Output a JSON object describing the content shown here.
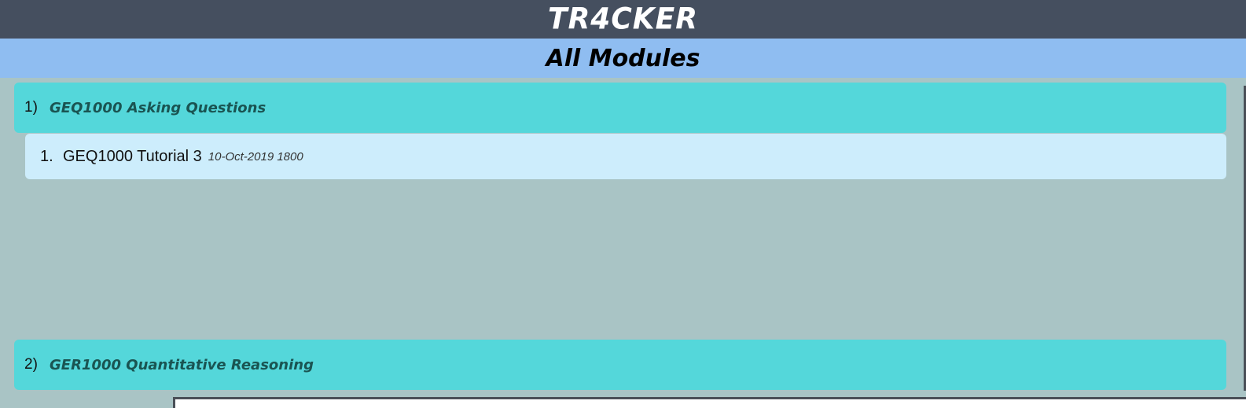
{
  "app": {
    "title": "TR4CKER"
  },
  "view": {
    "title": "All Modules"
  },
  "modules": [
    {
      "index": "1)",
      "name": "GEQ1000 Asking Questions",
      "tasks": [
        {
          "index": "1.",
          "name": "GEQ1000 Tutorial 3",
          "deadline": "10-Oct-2019 1800"
        }
      ]
    },
    {
      "index": "2)",
      "name": "GER1000 Quantitative Reasoning",
      "tasks": []
    }
  ],
  "command_box": {
    "value": ""
  },
  "colors": {
    "app_header_bg": "#454f5f",
    "view_header_bg": "#8fbdf1",
    "body_bg": "#a9c4c5",
    "module_card_bg": "#54d7da",
    "task_card_bg": "#cdedfc"
  }
}
